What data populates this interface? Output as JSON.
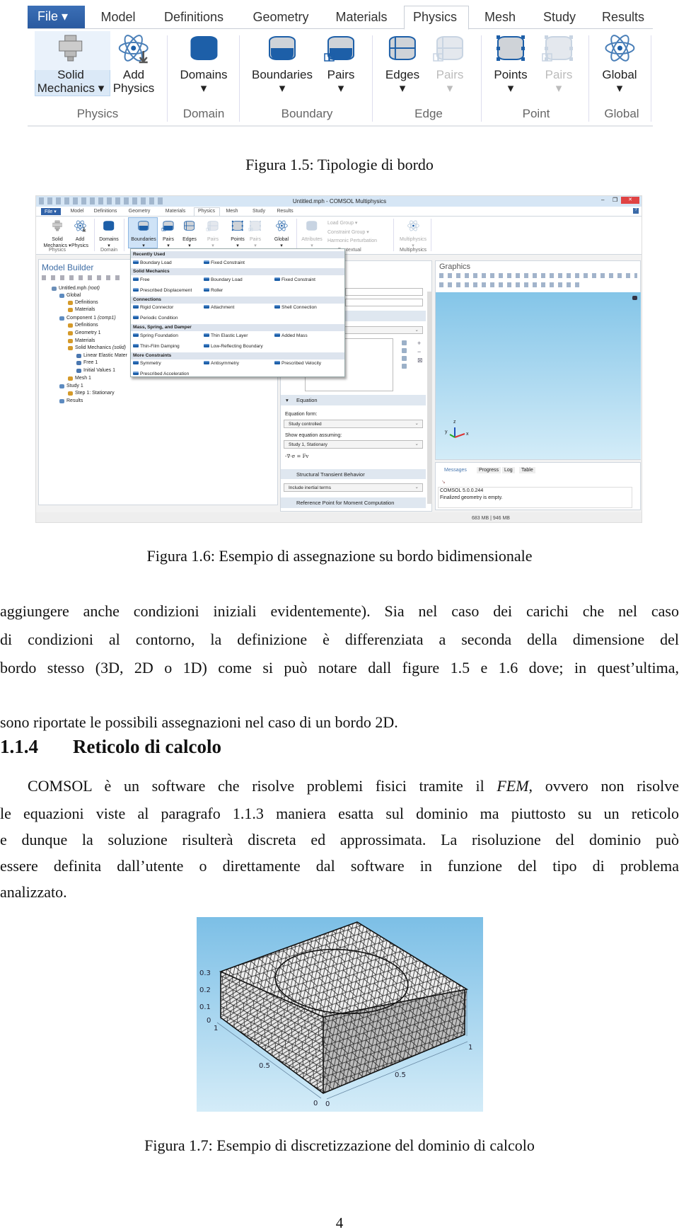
{
  "figure_1_5": {
    "file_tab": "File ▾",
    "tabs": [
      "Model",
      "Definitions",
      "Geometry",
      "Materials",
      "Physics",
      "Mesh",
      "Study",
      "Results"
    ],
    "active_tab": "Physics",
    "buttons": [
      {
        "line1": "Solid",
        "line2": "Mechanics ▾",
        "icon": "solid-mechanics-icon",
        "disabled": false
      },
      {
        "line1": "Add",
        "line2": "Physics",
        "icon": "add-physics-atom-icon",
        "disabled": false
      },
      {
        "line1": "Domains",
        "line2": "▾",
        "icon": "domains-icon",
        "disabled": false
      },
      {
        "line1": "Boundaries",
        "line2": "▾",
        "icon": "boundaries-icon",
        "disabled": false
      },
      {
        "line1": "Pairs",
        "line2": "▾",
        "icon": "boundary-pairs-icon",
        "disabled": false
      },
      {
        "line1": "Edges",
        "line2": "▾",
        "icon": "edges-icon",
        "disabled": false
      },
      {
        "line1": "Pairs",
        "line2": "▾",
        "icon": "edge-pairs-icon",
        "disabled": true
      },
      {
        "line1": "Points",
        "line2": "▾",
        "icon": "points-icon",
        "disabled": false
      },
      {
        "line1": "Pairs",
        "line2": "▾",
        "icon": "point-pairs-icon",
        "disabled": true
      },
      {
        "line1": "Global",
        "line2": "▾",
        "icon": "global-atom-icon",
        "disabled": false
      }
    ],
    "groups": [
      "Physics",
      "Domain",
      "Boundary",
      "Edge",
      "Point",
      "Global"
    ],
    "caption": "Figura 1.5: Tipologie di bordo"
  },
  "figure_1_6": {
    "window_title": "Untitled.mph - COMSOL Multiphysics",
    "window_controls": {
      "minimize": "–",
      "restore": "❐",
      "close": "✕",
      "help": "?"
    },
    "file_tab": "File ▾",
    "tabs": [
      "Model",
      "Definitions",
      "Geometry",
      "Materials",
      "Physics",
      "Mesh",
      "Study",
      "Results"
    ],
    "active_tab": "Physics",
    "ribbon_buttons": [
      {
        "line1": "Solid",
        "line2": "Mechanics ▾",
        "disabled": false
      },
      {
        "line1": "Add",
        "line2": "Physics",
        "disabled": false
      },
      {
        "line1": "Domains",
        "line2": "▾",
        "disabled": false
      },
      {
        "line1": "Boundaries",
        "line2": "▾",
        "disabled": false
      },
      {
        "line1": "Pairs",
        "line2": "▾",
        "disabled": false
      },
      {
        "line1": "Edges",
        "line2": "▾",
        "disabled": false
      },
      {
        "line1": "Pairs",
        "line2": "▾",
        "disabled": true
      },
      {
        "line1": "Points",
        "line2": "▾",
        "disabled": false
      },
      {
        "line1": "Pairs",
        "line2": "▾",
        "disabled": true
      },
      {
        "line1": "Global",
        "line2": "▾",
        "disabled": false
      },
      {
        "line1": "Attributes",
        "line2": "▾",
        "disabled": true
      },
      {
        "line1": "Multiphysics",
        "line2": "▾",
        "disabled": true
      }
    ],
    "contextual_items": [
      "Load Group ▾",
      "Constraint Group ▾",
      "Harmonic Perturbation"
    ],
    "groups": [
      "Physics",
      "Domain",
      "Contextual",
      "Multiphysics"
    ],
    "model_builder": {
      "title": "Model Builder",
      "tree": [
        {
          "label": "Untitled.mph",
          "suffix": " (root)",
          "level": 0
        },
        {
          "label": "Global",
          "suffix": "",
          "level": 1
        },
        {
          "label": "Definitions",
          "suffix": "",
          "level": 2
        },
        {
          "label": "Materials",
          "suffix": "",
          "level": 2
        },
        {
          "label": "Component 1",
          "suffix": " (comp1)",
          "level": 1
        },
        {
          "label": "Definitions",
          "suffix": "",
          "level": 2
        },
        {
          "label": "Geometry 1",
          "suffix": "",
          "level": 2
        },
        {
          "label": "Materials",
          "suffix": "",
          "level": 2
        },
        {
          "label": "Solid Mechanics",
          "suffix": " (solid)",
          "level": 2
        },
        {
          "label": "Linear Elastic Mater",
          "suffix": "",
          "level": 3
        },
        {
          "label": "Free 1",
          "suffix": "",
          "level": 3
        },
        {
          "label": "Initial Values 1",
          "suffix": "",
          "level": 3
        },
        {
          "label": "Mesh 1",
          "suffix": "",
          "level": 2
        },
        {
          "label": "Study 1",
          "suffix": "",
          "level": 1
        },
        {
          "label": "Step 1: Stationary",
          "suffix": "",
          "level": 2
        },
        {
          "label": "Results",
          "suffix": "",
          "level": 1
        }
      ]
    },
    "boundaries_menu": {
      "sections": [
        {
          "title": "Recently Used",
          "rows": [
            [
              "Boundary Load",
              "Fixed Constraint"
            ]
          ]
        },
        {
          "title": "Solid Mechanics",
          "rows": [
            [
              "Free",
              "Boundary Load",
              "Fixed Constraint"
            ],
            [
              "Prescribed Displacement",
              "Roller"
            ]
          ]
        },
        {
          "title": "Connections",
          "rows": [
            [
              "Rigid Connector",
              "Attachment",
              "Shell Connection"
            ],
            [
              "Periodic Condition"
            ]
          ]
        },
        {
          "title": "Mass, Spring, and Damper",
          "rows": [
            [
              "Spring Foundation",
              "Thin Elastic Layer",
              "Added Mass"
            ],
            [
              "Thin-Film Damping",
              "Low-Reflecting Boundary"
            ]
          ]
        },
        {
          "title": "More Constraints",
          "rows": [
            [
              "Symmetry",
              "Antisymmetry",
              "Prescribed Velocity"
            ],
            [
              "Prescribed Acceleration"
            ]
          ]
        }
      ]
    },
    "settings": {
      "equation_section": "Equation",
      "equation_form_label": "Equation form:",
      "equation_form_value": "Study controlled",
      "show_equation_label": "Show equation assuming:",
      "show_equation_value": "Study 1, Stationary",
      "equation": "-∇·σ = Fv",
      "transient_section": "Structural Transient Behavior",
      "transient_value": "Include inertial terms",
      "reference_section": "Reference Point for Moment Computation"
    },
    "graphics": {
      "title": "Graphics",
      "axes": {
        "x": "x",
        "y": "y",
        "z": "z"
      }
    },
    "messages": {
      "tabs": [
        "Messages",
        "Progress",
        "Log",
        "Table"
      ],
      "active_tab": "Messages",
      "lines": [
        "COMSOL 5.0.0.244",
        "Finalized geometry is empty."
      ]
    },
    "status_bar": "683 MB | 946 MB",
    "caption": "Figura 1.6: Esempio di assegnazione su bordo bidimensionale"
  },
  "body": {
    "paragraph_1": [
      "aggiungere anche condizioni iniziali evidentemente). Sia nel caso dei carichi che nel caso",
      "di condizioni al contorno, la definizione è differenziata a seconda della dimensione del",
      "bordo stesso (3D, 2D o 1D) come si può notare dall figure 1.5 e 1.6 dove; in quest’ultima,",
      "sono riportate le possibili assegnazioni nel caso di un bordo 2D."
    ],
    "section_number": "1.1.4",
    "section_title": "Reticolo di calcolo",
    "paragraph_2": {
      "line1_a": "COMSOL è un software che risolve problemi fisici tramite il ",
      "line1_em": "FEM",
      "line1_b": ", ovvero non risolve",
      "lines": [
        "le equazioni viste al paragrafo 1.1.3 maniera esatta sul dominio ma piuttosto su un reticolo",
        "e dunque la soluzione risulterà discreta ed approssimata. La risoluzione del dominio può",
        "essere definita dall’utente o direttamente dal software in funzione del tipo di problema",
        "analizzato."
      ]
    }
  },
  "figure_1_7": {
    "z_ticks": [
      "0.3",
      "0.2",
      "0.1",
      "0"
    ],
    "y_ticks": [
      "1",
      "0.5",
      "0"
    ],
    "x_ticks": [
      "0",
      "0.5",
      "1"
    ],
    "caption": "Figura 1.7: Esempio di discretizzazione del dominio di calcolo"
  },
  "page_number": "4"
}
